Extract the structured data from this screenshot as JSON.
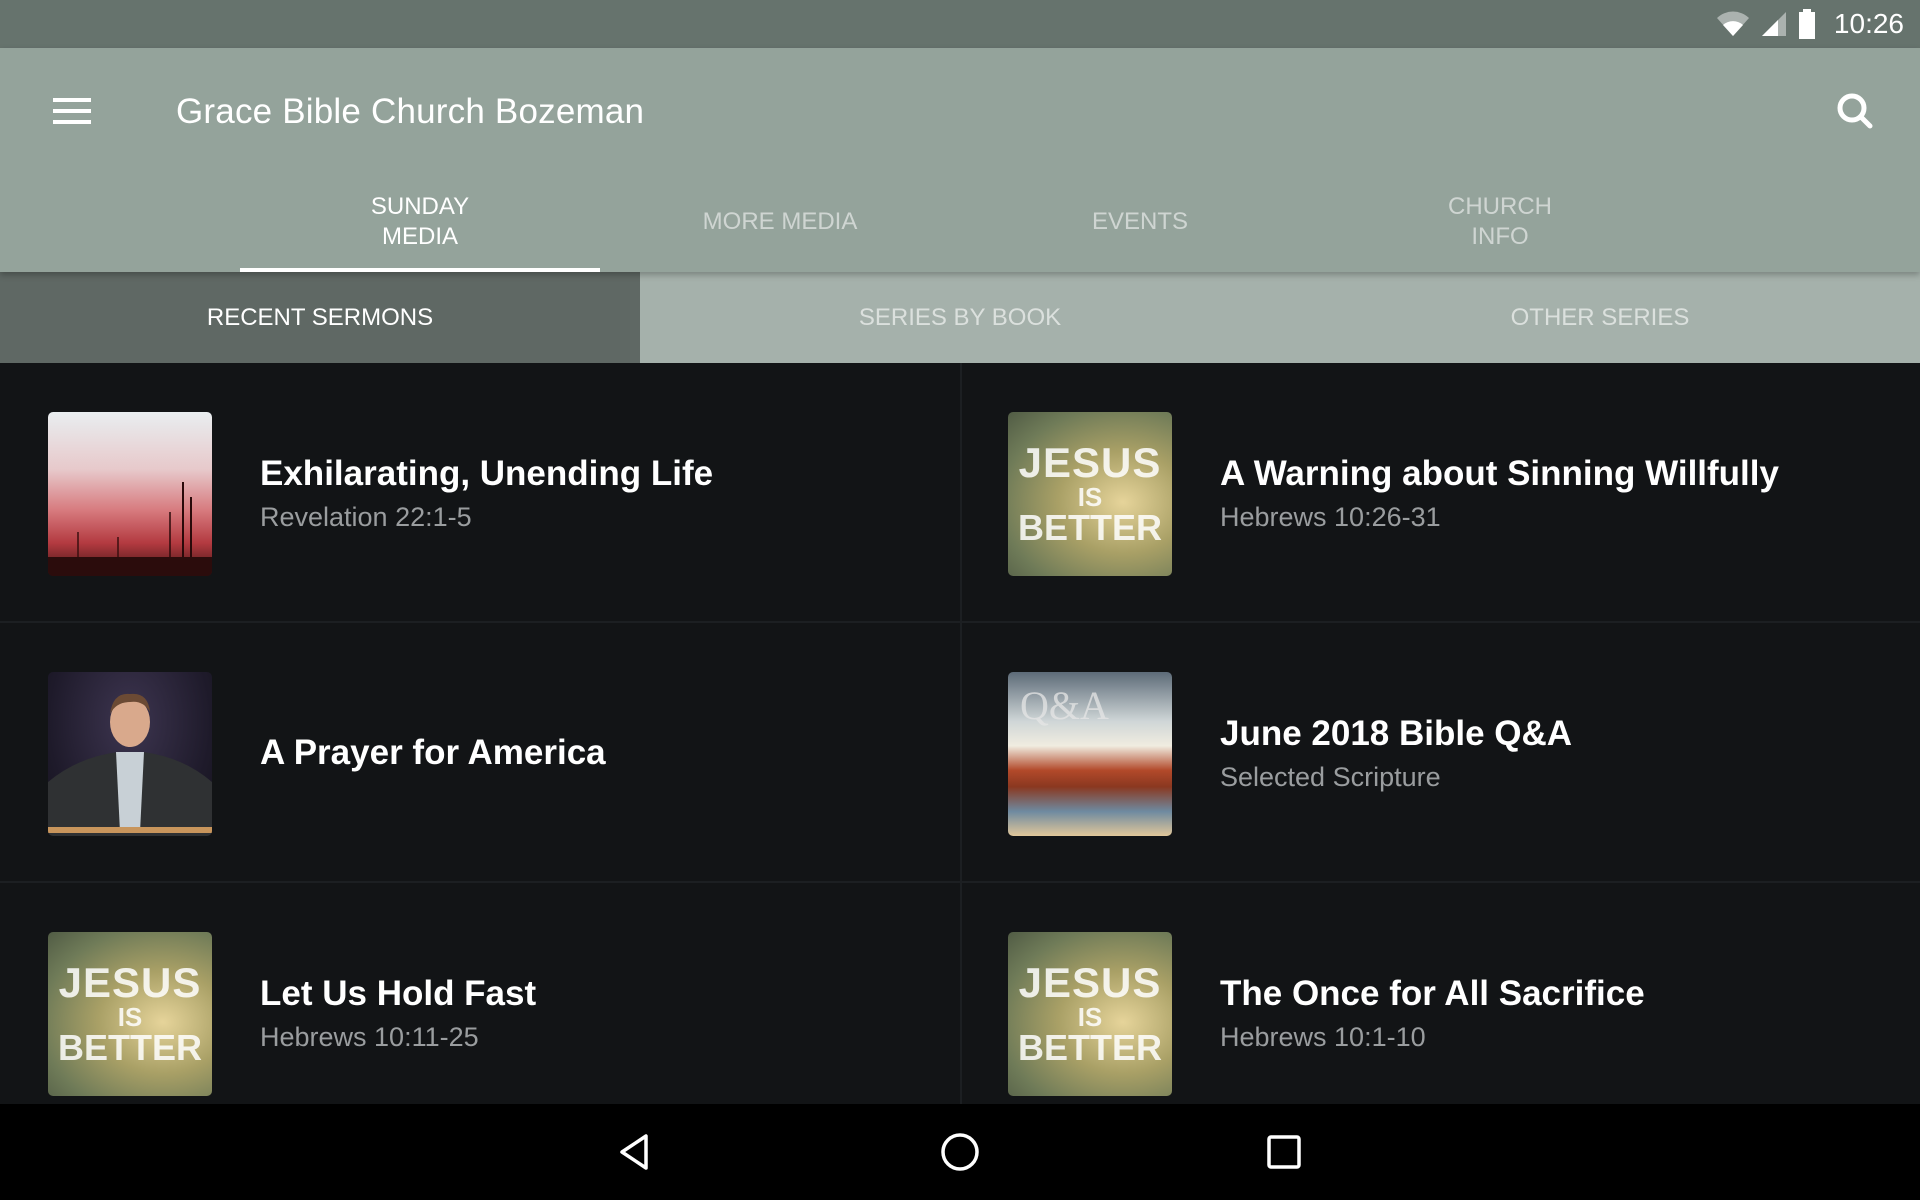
{
  "status_bar": {
    "time": "10:26",
    "icons": [
      "wifi-icon",
      "cell-signal-icon",
      "battery-icon"
    ]
  },
  "app_bar": {
    "title": "Grace Bible Church Bozeman",
    "menu_icon": "hamburger-menu-icon",
    "search_icon": "search-icon"
  },
  "tabs": [
    {
      "label": "SUNDAY\nMEDIA",
      "active": true
    },
    {
      "label": "MORE MEDIA",
      "active": false
    },
    {
      "label": "EVENTS",
      "active": false
    },
    {
      "label": "CHURCH\nINFO",
      "active": false
    }
  ],
  "subtabs": [
    {
      "label": "RECENT SERMONS",
      "active": true
    },
    {
      "label": "SERIES BY BOOK",
      "active": false
    },
    {
      "label": "OTHER SERIES",
      "active": false
    }
  ],
  "sermons": [
    {
      "title": "Exhilarating, Unending Life",
      "subtitle": "Revelation 22:1-5",
      "thumbnail": "red-misty-forest"
    },
    {
      "title": "A Warning about Sinning Willfully",
      "subtitle": "Hebrews 10:26-31",
      "thumbnail": "jesus-is-better"
    },
    {
      "title": "A Prayer for America",
      "subtitle": "",
      "thumbnail": "pastor-at-pulpit"
    },
    {
      "title": "June 2018 Bible Q&A",
      "subtitle": "Selected Scripture",
      "thumbnail": "qa-open-bible"
    },
    {
      "title": "Let Us Hold Fast",
      "subtitle": "Hebrews 10:11-25",
      "thumbnail": "jesus-is-better"
    },
    {
      "title": "The Once for All Sacrifice",
      "subtitle": "Hebrews 10:1-10",
      "thumbnail": "jesus-is-better"
    }
  ],
  "thumbnail_text": {
    "jesus": [
      "JESUS",
      "IS",
      "BETTER"
    ],
    "qa": "Q&A"
  },
  "nav_bar": {
    "back": "back-icon",
    "home": "home-icon",
    "recents": "recents-icon"
  },
  "colors": {
    "status_bar": "#66736d",
    "app_bar": "#94a39b",
    "subtab_bar": "#a5b1ab",
    "subtab_active": "#5f6864",
    "list_background": "#121416"
  }
}
